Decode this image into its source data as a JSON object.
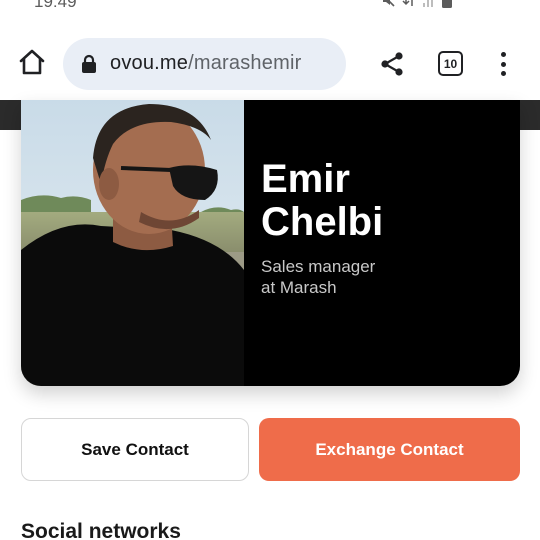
{
  "status_bar": {
    "time": "19:49",
    "icons": [
      "mute-icon",
      "data-transfer-icon",
      "signal-icon",
      "battery-icon"
    ]
  },
  "browser": {
    "url_domain": "ovou.me",
    "url_path": "/marashemir",
    "tab_count": "10",
    "icons": [
      "home-icon",
      "lock-icon",
      "share-icon",
      "tabs-icon",
      "more-vert-icon"
    ]
  },
  "profile": {
    "name_first": "Emir",
    "name_last": "Chelbi",
    "title_line1": "Sales manager",
    "title_line2": "at Marash"
  },
  "actions": {
    "save_label": "Save Contact",
    "exchange_label": "Exchange Contact"
  },
  "sections": {
    "social_title": "Social networks"
  },
  "colors": {
    "accent": "#ef6c4a",
    "card_bg": "#000000",
    "url_pill_bg": "#e9eef6"
  }
}
